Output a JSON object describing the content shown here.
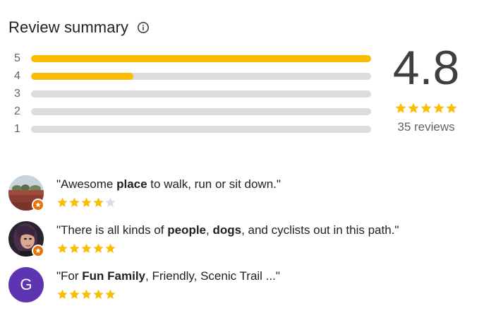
{
  "header": {
    "title": "Review summary",
    "info_icon": "info-icon"
  },
  "distribution": [
    {
      "label": "5",
      "fraction": 1.0
    },
    {
      "label": "4",
      "fraction": 0.3
    },
    {
      "label": "3",
      "fraction": 0.0
    },
    {
      "label": "2",
      "fraction": 0.0
    },
    {
      "label": "1",
      "fraction": 0.0
    }
  ],
  "overall": {
    "rating": "4.8",
    "stars": 5,
    "reviews_text": "35 reviews"
  },
  "snippets": [
    {
      "avatar": "photo",
      "avatar_desc_icon": "landscape-avatar",
      "badge_icon": "local-guide-badge-icon",
      "parts": [
        {
          "t": "\"Awesome ",
          "b": false
        },
        {
          "t": "place",
          "b": true
        },
        {
          "t": " to walk, run or sit down.\"",
          "b": false
        }
      ],
      "stars": 4
    },
    {
      "avatar": "photo",
      "avatar_desc_icon": "person-avatar",
      "badge_icon": "local-guide-badge-icon",
      "parts": [
        {
          "t": "\"There is all kinds of ",
          "b": false
        },
        {
          "t": "people",
          "b": true
        },
        {
          "t": ", ",
          "b": false
        },
        {
          "t": "dogs",
          "b": true
        },
        {
          "t": ", and cyclists out in this path.\"",
          "b": false
        }
      ],
      "stars": 5
    },
    {
      "avatar": "letter",
      "avatar_letter": "G",
      "parts": [
        {
          "t": "\"For ",
          "b": false
        },
        {
          "t": "Fun Family",
          "b": true
        },
        {
          "t": ", Friendly, Scenic Trail ...\"",
          "b": false
        }
      ],
      "stars": 5
    }
  ],
  "colors": {
    "star_filled": "#fbbc04",
    "star_empty": "#dadce0",
    "bar_track": "#dadce0",
    "bar_fill": "#fbbc04",
    "letter_avatar_bg": "#5e35b1",
    "badge": "#e8710a"
  }
}
